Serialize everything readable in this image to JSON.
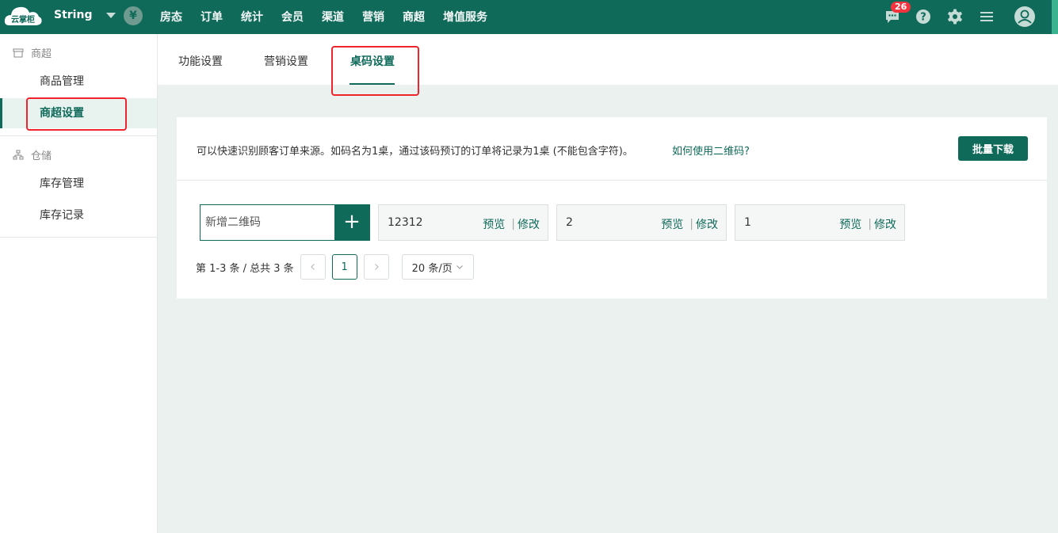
{
  "brand": {
    "logo_text": "云掌柜",
    "color": "#0f6a5a"
  },
  "header": {
    "store_name": "String",
    "currency_symbol": "¥",
    "nav": [
      "房态",
      "订单",
      "统计",
      "会员",
      "渠道",
      "营销",
      "商超",
      "增值服务"
    ],
    "active_nav": "商超",
    "message_badge": "26",
    "icons": [
      "message-icon",
      "help-icon",
      "gear-icon",
      "menu-icon",
      "user-avatar-icon"
    ]
  },
  "sidebar": {
    "groups": [
      {
        "title": "商超",
        "icon": "store-icon",
        "items": [
          "商品管理",
          "商超设置"
        ]
      },
      {
        "title": "仓储",
        "icon": "warehouse-icon",
        "items": [
          "库存管理",
          "库存记录"
        ]
      }
    ],
    "active_item": "商超设置"
  },
  "tabs": {
    "items": [
      "功能设置",
      "营销设置",
      "桌码设置"
    ],
    "active": "桌码设置"
  },
  "content": {
    "hint": "可以快速识别顾客订单来源。如码名为1桌，通过该码预订的订单将记录为1桌 (不能包含字符)。",
    "help_link": "如何使用二维码?",
    "batch_download": "批量下载",
    "add_placeholder": "新增二维码",
    "add_button": "+",
    "qr_codes": [
      {
        "name": "12312",
        "preview": "预览",
        "edit": "修改"
      },
      {
        "name": "2",
        "preview": "预览",
        "edit": "修改"
      },
      {
        "name": "1",
        "preview": "预览",
        "edit": "修改"
      }
    ],
    "pagination": {
      "summary": "第 1-3 条 / 总共 3 条",
      "current_page": "1",
      "page_size": "20 条/页"
    }
  }
}
